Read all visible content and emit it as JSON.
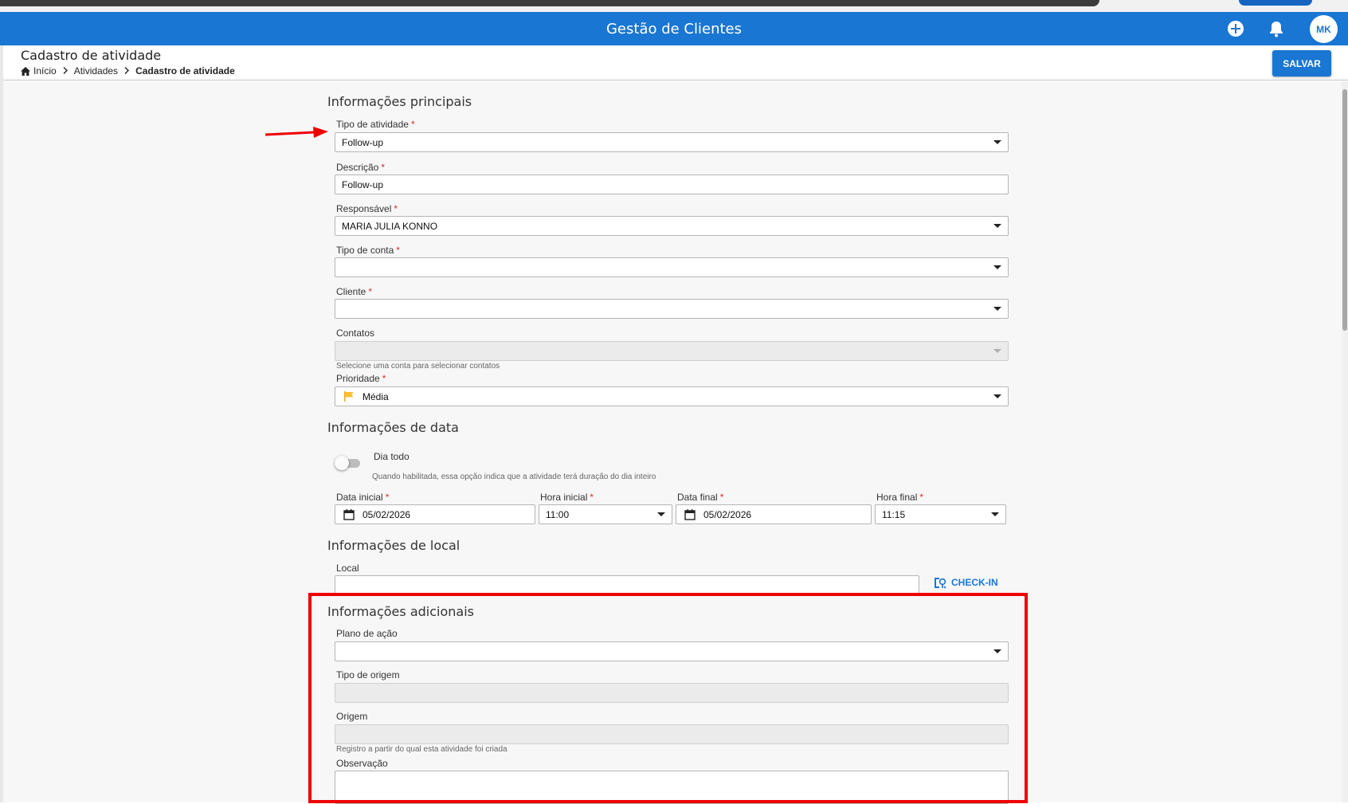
{
  "header": {
    "title": "Gestão de Clientes",
    "avatar_initials": "MK"
  },
  "page": {
    "title": "Cadastro de atividade",
    "breadcrumb": [
      "Início",
      "Atividades",
      "Cadastro de atividade"
    ],
    "save_label": "SALVAR"
  },
  "main_info": {
    "section_title": "Informações principais",
    "tipo_atividade": {
      "label": "Tipo de atividade",
      "value": "Follow-up"
    },
    "descricao": {
      "label": "Descrição",
      "value": "Follow-up"
    },
    "responsavel": {
      "label": "Responsável",
      "value": "MARIA JULIA KONNO"
    },
    "tipo_conta": {
      "label": "Tipo de conta",
      "value": ""
    },
    "cliente": {
      "label": "Cliente",
      "value": ""
    },
    "contatos": {
      "label": "Contatos",
      "value": "",
      "hint": "Selecione uma conta para selecionar contatos"
    },
    "prioridade": {
      "label": "Prioridade",
      "value": "Média",
      "flag_color": "#fbc02d"
    }
  },
  "date_info": {
    "section_title": "Informações de data",
    "dia_todo": {
      "label": "Dia todo",
      "hint": "Quando habilitada, essa opção indica que a atividade terá duração do dia inteiro",
      "enabled": false
    },
    "data_inicial": {
      "label": "Data inicial",
      "value": "05/02/2026"
    },
    "hora_inicial": {
      "label": "Hora inicial",
      "value": "11:00"
    },
    "data_final": {
      "label": "Data final",
      "value": "05/02/2026"
    },
    "hora_final": {
      "label": "Hora final",
      "value": "11:15"
    }
  },
  "location_info": {
    "section_title": "Informações de local",
    "local": {
      "label": "Local",
      "value": ""
    },
    "checkin_label": "CHECK-IN"
  },
  "additional_info": {
    "section_title": "Informações adicionais",
    "plano_acao": {
      "label": "Plano de ação",
      "value": ""
    },
    "tipo_origem": {
      "label": "Tipo de origem",
      "value": ""
    },
    "origem": {
      "label": "Origem",
      "value": "",
      "hint": "Registro a partir do qual esta atividade foi criada"
    },
    "observacao": {
      "label": "Observação",
      "value": ""
    }
  },
  "required_mark": "*",
  "colors": {
    "primary": "#1976d2",
    "annotation_red": "#ee0000",
    "required_red": "#d32f2f"
  }
}
